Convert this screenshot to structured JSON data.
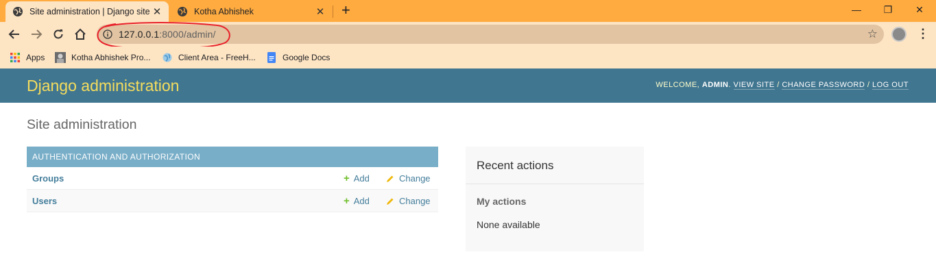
{
  "browser": {
    "tabs": [
      {
        "title": "Site administration | Django site admin",
        "active": true
      },
      {
        "title": "Kotha Abhishek",
        "active": false
      }
    ],
    "new_tab_symbol": "+",
    "window_controls": {
      "minimize": "—",
      "restore": "❐",
      "close": "✕"
    },
    "url_host": "127.0.0.1",
    "url_rest": ":8000/admin/",
    "bookmarks": [
      {
        "label": "Apps",
        "icon": "apps-grid-icon"
      },
      {
        "label": "Kotha Abhishek Pro...",
        "icon": "profile-thumb-icon"
      },
      {
        "label": "Client Area - FreeH...",
        "icon": "globe-icon"
      },
      {
        "label": "Google Docs",
        "icon": "google-docs-icon"
      }
    ],
    "colors": {
      "tabbar": "#ffab40",
      "toolbar": "#fde4c3",
      "omnibox": "#e2c4a2",
      "annotation": "#e8202a"
    }
  },
  "admin": {
    "site_header": "Django administration",
    "user_tools": {
      "welcome": "Welcome,",
      "username": "admin",
      "view_site": "View site",
      "change_password": "Change password",
      "log_out": "Log out"
    },
    "page_title": "Site administration",
    "apps": [
      {
        "caption": "Authentication and Authorization",
        "models": [
          {
            "name": "Groups",
            "add": "Add",
            "change": "Change"
          },
          {
            "name": "Users",
            "add": "Add",
            "change": "Change"
          }
        ]
      }
    ],
    "recent_actions": {
      "heading": "Recent actions",
      "subheading": "My actions",
      "empty": "None available"
    },
    "colors": {
      "header": "#417690",
      "branding": "#f5dd5d",
      "module_caption": "#79aec8",
      "link": "#447e9b",
      "add_icon": "#70bf2b"
    }
  }
}
